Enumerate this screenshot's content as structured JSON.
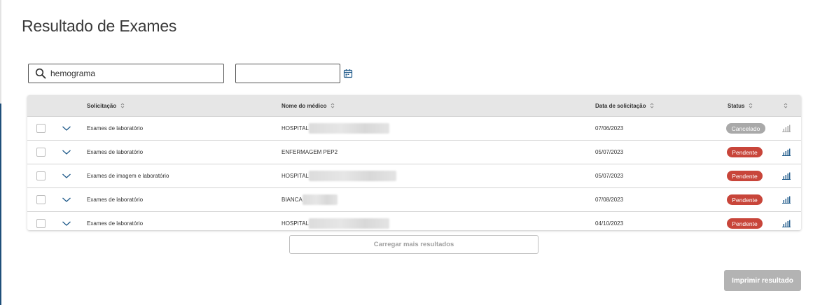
{
  "page": {
    "title": "Resultado de Exames"
  },
  "filters": {
    "search_value": "hemograma",
    "date_value": ""
  },
  "table": {
    "headers": {
      "solicitacao": "Solicitação",
      "medico": "Nome do médico",
      "data": "Data de solicitação",
      "status": "Status"
    },
    "rows": [
      {
        "solicitacao": "Exames de laboratório",
        "medico": "HOSPITAL",
        "data": "07/06/2023",
        "status": "Cancelado",
        "status_type": "cancelado"
      },
      {
        "solicitacao": "Exames de laboratório",
        "medico": "ENFERMAGEM PEP2",
        "data": "05/07/2023",
        "status": "Pendente",
        "status_type": "pendente"
      },
      {
        "solicitacao": "Exames de imagem e laboratório",
        "medico": "HOSPITAL",
        "data": "05/07/2023",
        "status": "Pendente",
        "status_type": "pendente"
      },
      {
        "solicitacao": "Exames de laboratório",
        "medico": "BIANCA",
        "data": "07/08/2023",
        "status": "Pendente",
        "status_type": "pendente"
      },
      {
        "solicitacao": "Exames de laboratório",
        "medico": "HOSPITAL",
        "data": "04/10/2023",
        "status": "Pendente",
        "status_type": "pendente"
      }
    ]
  },
  "actions": {
    "load_more": "Carregar mais resultados",
    "print": "Imprimir resultado"
  },
  "colors": {
    "pendente": "#c8453a",
    "cancelado": "#a9a9a9",
    "accent": "#1f5a8a"
  }
}
